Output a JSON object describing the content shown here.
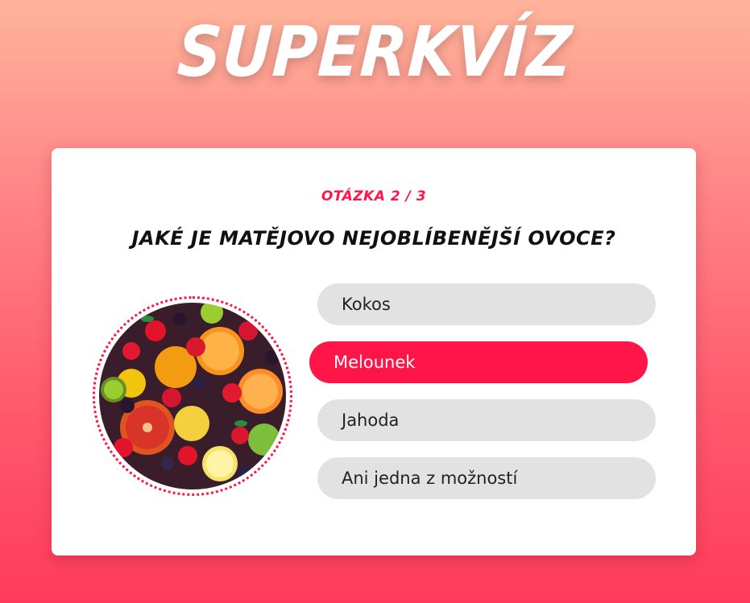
{
  "app": {
    "logo_text": "SUPERKVÍZ"
  },
  "quiz": {
    "counter": "OTÁZKA 2 / 3",
    "question": "JAKÉ JE MATĚJOVO NEJOBLÍBENĚJŠÍ OVOCE?",
    "image_icon": "fruit-photo",
    "answers": [
      {
        "label": "Kokos",
        "selected": false
      },
      {
        "label": "Melounek",
        "selected": true
      },
      {
        "label": "Jahoda",
        "selected": false
      },
      {
        "label": "Ani jedna z možností",
        "selected": false
      }
    ]
  },
  "colors": {
    "accent": "#ff1547",
    "answer_bg": "#e2e2e2",
    "card_bg": "#ffffff"
  }
}
